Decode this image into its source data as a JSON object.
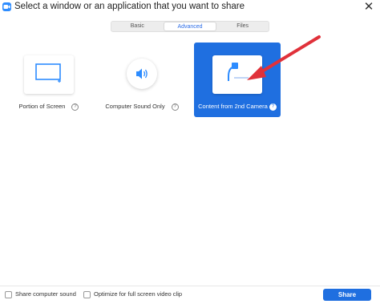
{
  "window": {
    "title": "Select a window or an application that you want to share",
    "close_glyph": "✕",
    "app_icon": "zoom-camera-icon"
  },
  "tabs": [
    {
      "label": "Basic",
      "active": false
    },
    {
      "label": "Advanced",
      "active": true
    },
    {
      "label": "Files",
      "active": false
    }
  ],
  "options": [
    {
      "label": "Portion of Screen",
      "icon": "screen-portion-icon",
      "selected": false
    },
    {
      "label": "Computer Sound Only",
      "icon": "speaker-icon",
      "selected": false
    },
    {
      "label": "Content from 2nd Camera",
      "icon": "document-camera-icon",
      "selected": true
    }
  ],
  "help_glyph": "?",
  "footer": {
    "share_sound_label": "Share computer sound",
    "optimize_label": "Optimize for full screen video clip",
    "share_button": "Share",
    "share_sound_checked": false,
    "optimize_checked": false
  },
  "colors": {
    "accent": "#1f6fe0",
    "annotation_arrow": "#e0313a",
    "icon_blue": "#2d8cff"
  }
}
